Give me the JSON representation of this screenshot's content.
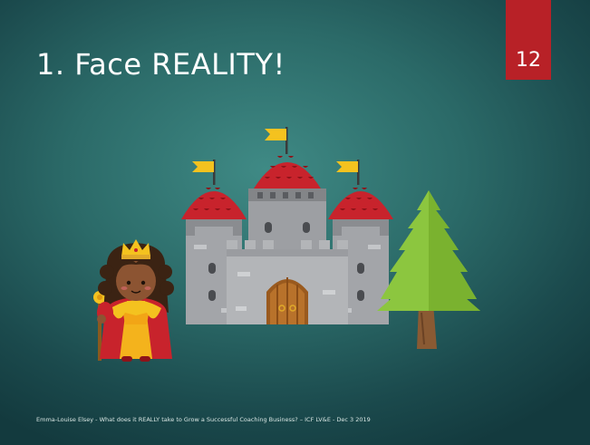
{
  "slide": {
    "title": "1. Face REALITY!",
    "page_number": "12",
    "footer": "Emma-Louise Elsey - What does it REALLY take to Grow a Successful Coaching Business? – ICF LV&E - Dec 3 2019"
  },
  "illustration": {
    "subjects": [
      "queen",
      "castle",
      "pine-tree"
    ]
  },
  "colors": {
    "background": "#2b6a68",
    "badge": "#b82127",
    "castle_stone": "#a7a9ac",
    "roof": "#c8232c",
    "flag": "#f4c21f",
    "tree": "#8cc63f"
  }
}
